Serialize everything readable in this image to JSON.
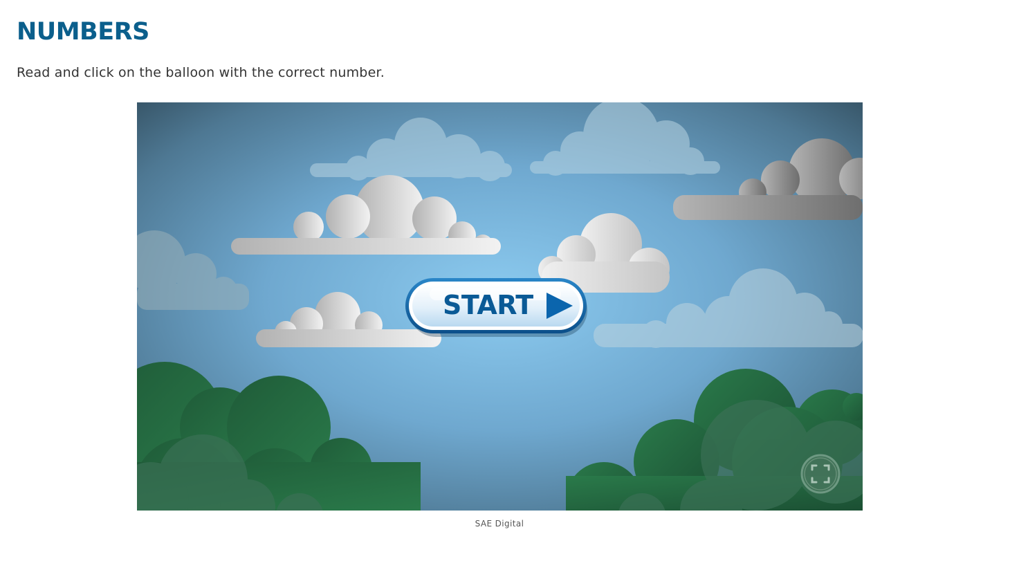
{
  "page": {
    "title": "NUMBERS",
    "instruction": "Read and click on the balloon with the correct number."
  },
  "game": {
    "start_label": "START",
    "fullscreen_icon": "fullscreen-icon",
    "play_icon": "play-triangle-icon"
  },
  "credit": "SAE Digital",
  "colors": {
    "title": "#0b5f8c",
    "sky_center": "#8ccbf0",
    "sky_edge": "#3d5b6e",
    "tree_green": "#236b43",
    "button_blue": "#0a5a96"
  }
}
